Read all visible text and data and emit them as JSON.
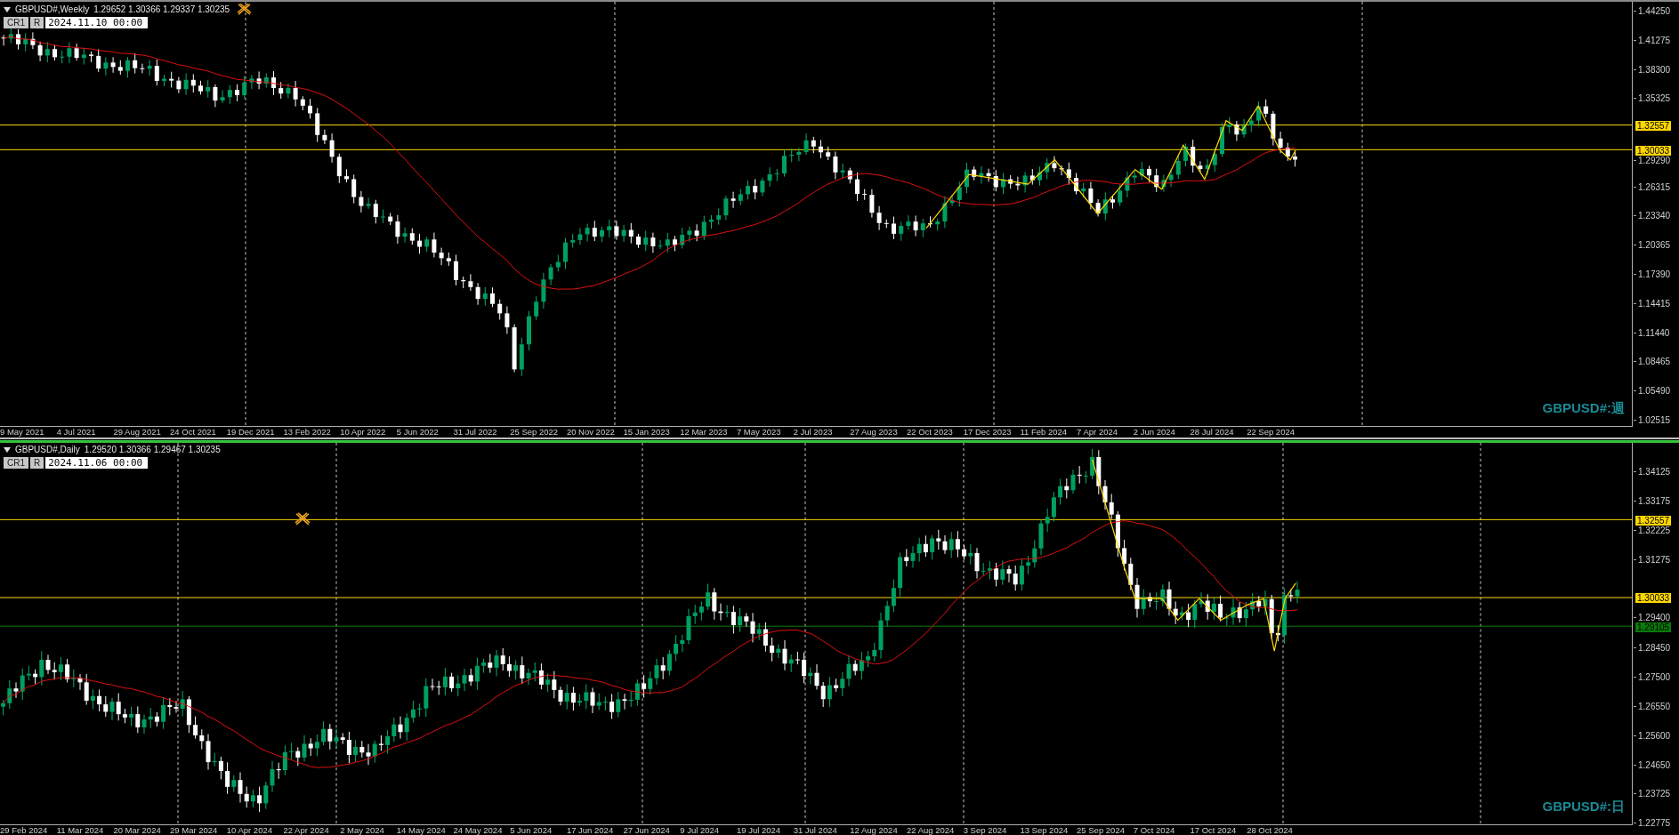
{
  "panes": [
    {
      "kind": "weekly",
      "symbol": "GBPUSD#,Weekly",
      "ohlc": "1.29652 1.30366 1.29337 1.30235",
      "buttons": [
        "CR1",
        "R"
      ],
      "date_field": "2024.11.10 00:00",
      "watermark": "GBPUSD#:週",
      "price_ticks": [
        "1.44250",
        "1.41275",
        "1.38300",
        "1.35325",
        "1.29290",
        "1.26315",
        "1.23340",
        "1.20365",
        "1.17390",
        "1.14415",
        "1.11440",
        "1.08465",
        "1.05490",
        "1.02515"
      ],
      "levels": [
        {
          "price": "1.32557",
          "color": "#ffd700"
        },
        {
          "price": "1.30033",
          "color": "#ffd700"
        }
      ],
      "time_labels": [
        "9 May 2021",
        "4 Jul 2021",
        "29 Aug 2021",
        "24 Oct 2021",
        "19 Dec 2021",
        "13 Feb 2022",
        "10 Apr 2022",
        "5 Jun 2022",
        "31 Jul 2022",
        "25 Sep 2022",
        "20 Nov 2022",
        "15 Jan 2023",
        "12 Mar 2023",
        "7 May 2023",
        "2 Jul 2023",
        "27 Aug 2023",
        "22 Oct 2023",
        "17 Dec 2023",
        "11 Feb 2024",
        "7 Apr 2024",
        "2 Jun 2024",
        "28 Jul 2024",
        "22 Sep 2024"
      ]
    },
    {
      "kind": "daily",
      "symbol": "GBPUSD#,Daily",
      "ohlc": "1.29520 1.30366 1.29467 1.30235",
      "buttons": [
        "CR1",
        "R"
      ],
      "date_field": "2024.11.06 00:00",
      "watermark": "GBPUSD#:日",
      "price_ticks": [
        "1.34125",
        "1.33175",
        "1.32225",
        "1.31275",
        "1.29400",
        "1.28450",
        "1.27500",
        "1.26550",
        "1.25600",
        "1.24650",
        "1.23725",
        "1.22775"
      ],
      "levels": [
        {
          "price": "1.32557",
          "color": "#ffd700"
        },
        {
          "price": "1.30033",
          "color": "#ffd700"
        },
        {
          "price": "1.29105",
          "color": "#0a7a0a"
        }
      ],
      "time_labels": [
        "29 Feb 2024",
        "11 Mar 2024",
        "20 Mar 2024",
        "29 Mar 2024",
        "10 Apr 2024",
        "22 Apr 2024",
        "2 May 2024",
        "14 May 2024",
        "24 May 2024",
        "5 Jun 2024",
        "17 Jun 2024",
        "27 Jun 2024",
        "9 Jul 2024",
        "19 Jul 2024",
        "31 Jul 2024",
        "12 Aug 2024",
        "22 Aug 2024",
        "3 Sep 2024",
        "13 Sep 2024",
        "25 Sep 2024",
        "7 Oct 2024",
        "17 Oct 2024",
        "28 Oct 2024"
      ]
    }
  ]
}
